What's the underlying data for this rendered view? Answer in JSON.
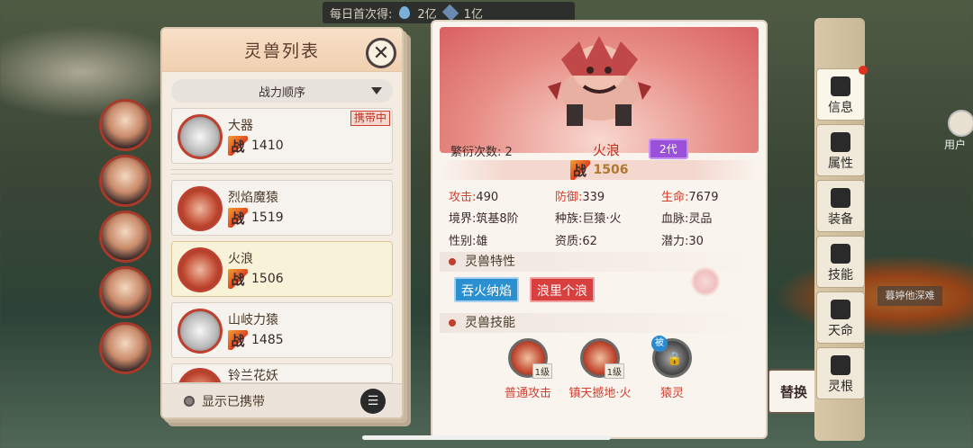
{
  "topbar": {
    "daily_label": "每日首次得:",
    "amount1": "2亿",
    "amount2": "1亿",
    "icon1": "water-drop-icon",
    "icon2": "gem-icon"
  },
  "list": {
    "title": "灵兽列表",
    "sort_label": "战力顺序",
    "zhan": "战",
    "carry_badge": "携带中",
    "items": [
      {
        "name": "大器",
        "power": "1410",
        "carried": true
      },
      {
        "name": "烈焰魔猿",
        "power": "1519"
      },
      {
        "name": "火浪",
        "power": "1506",
        "selected": true
      },
      {
        "name": "山岐力猿",
        "power": "1485"
      },
      {
        "name": "铃兰花妖"
      }
    ],
    "footer_label": "显示已携带"
  },
  "detail": {
    "breed_label": "繁衍次数:",
    "breed_value": "2",
    "name": "火浪",
    "generation": "2代",
    "zhan": "战",
    "power": "1506",
    "stats_main": [
      {
        "label": "攻击:",
        "value": "490"
      },
      {
        "label": "防御:",
        "value": "339"
      },
      {
        "label": "生命:",
        "value": "7679"
      }
    ],
    "stats": [
      {
        "label": "境界:",
        "value": "筑基8阶"
      },
      {
        "label": "种族:",
        "value": "巨猿·火"
      },
      {
        "label": "血脉:",
        "value": "灵品"
      },
      {
        "label": "性别:",
        "value": "雄"
      },
      {
        "label": "资质:",
        "value": "62"
      },
      {
        "label": "潜力:",
        "value": "30"
      }
    ],
    "traits_title": "灵兽特性",
    "traits": [
      "吞火纳焰",
      "浪里个浪"
    ],
    "skills_title": "灵兽技能",
    "skills": [
      {
        "name": "普通攻击",
        "level": "1级"
      },
      {
        "name": "镇天撼地·火",
        "level": "1级"
      },
      {
        "name": "猿灵",
        "passive": "被"
      }
    ],
    "accent_color": "#d04030",
    "gen_color": "#9a50d8"
  },
  "replace_label": "替换",
  "side_tabs": [
    "信息",
    "属性",
    "装备",
    "技能",
    "天命",
    "灵根"
  ],
  "user_label": "用户",
  "map_label": "暮婷他深难"
}
